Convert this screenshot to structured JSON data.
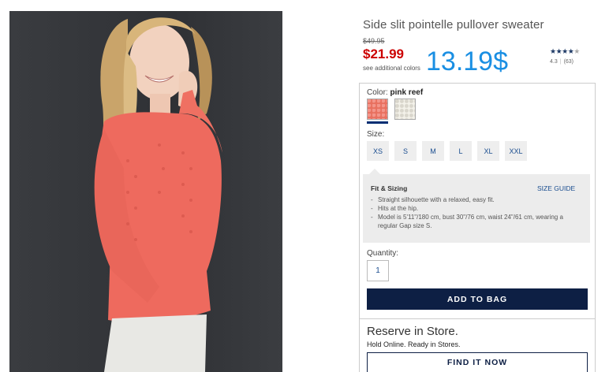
{
  "product": {
    "title": "Side slit pointelle pullover sweater",
    "original_price": "$49.95",
    "sale_price": "$21.99",
    "see_colors": "see additional colors",
    "converted_price": "13.19$"
  },
  "rating": {
    "stars": 4.3,
    "value": "4.3",
    "count": "(63)"
  },
  "color": {
    "label": "Color:",
    "selected": "pink reef",
    "swatches": [
      "pink reef",
      "white pattern"
    ]
  },
  "size": {
    "label": "Size:",
    "options": [
      "XS",
      "S",
      "M",
      "L",
      "XL",
      "XXL"
    ]
  },
  "fit": {
    "title": "Fit & Sizing",
    "size_guide": "SIZE GUIDE",
    "items": [
      "Straight silhouette with a relaxed, easy fit.",
      "Hits at the hip.",
      "Model is 5'11\"/180 cm, bust 30\"/76 cm, waist 24\"/61 cm, wearing a regular Gap size S."
    ]
  },
  "quantity": {
    "label": "Quantity:",
    "value": "1"
  },
  "actions": {
    "add_to_bag": "ADD TO BAG",
    "find_it_now": "FIND IT NOW"
  },
  "reserve": {
    "title": "Reserve in Store.",
    "subtitle": "Hold Online. Ready in Stores."
  },
  "colors": {
    "sale": "#cc0000",
    "converted": "#1a8fe3",
    "brand_navy": "#0d1f44",
    "link": "#1a4d8f"
  }
}
